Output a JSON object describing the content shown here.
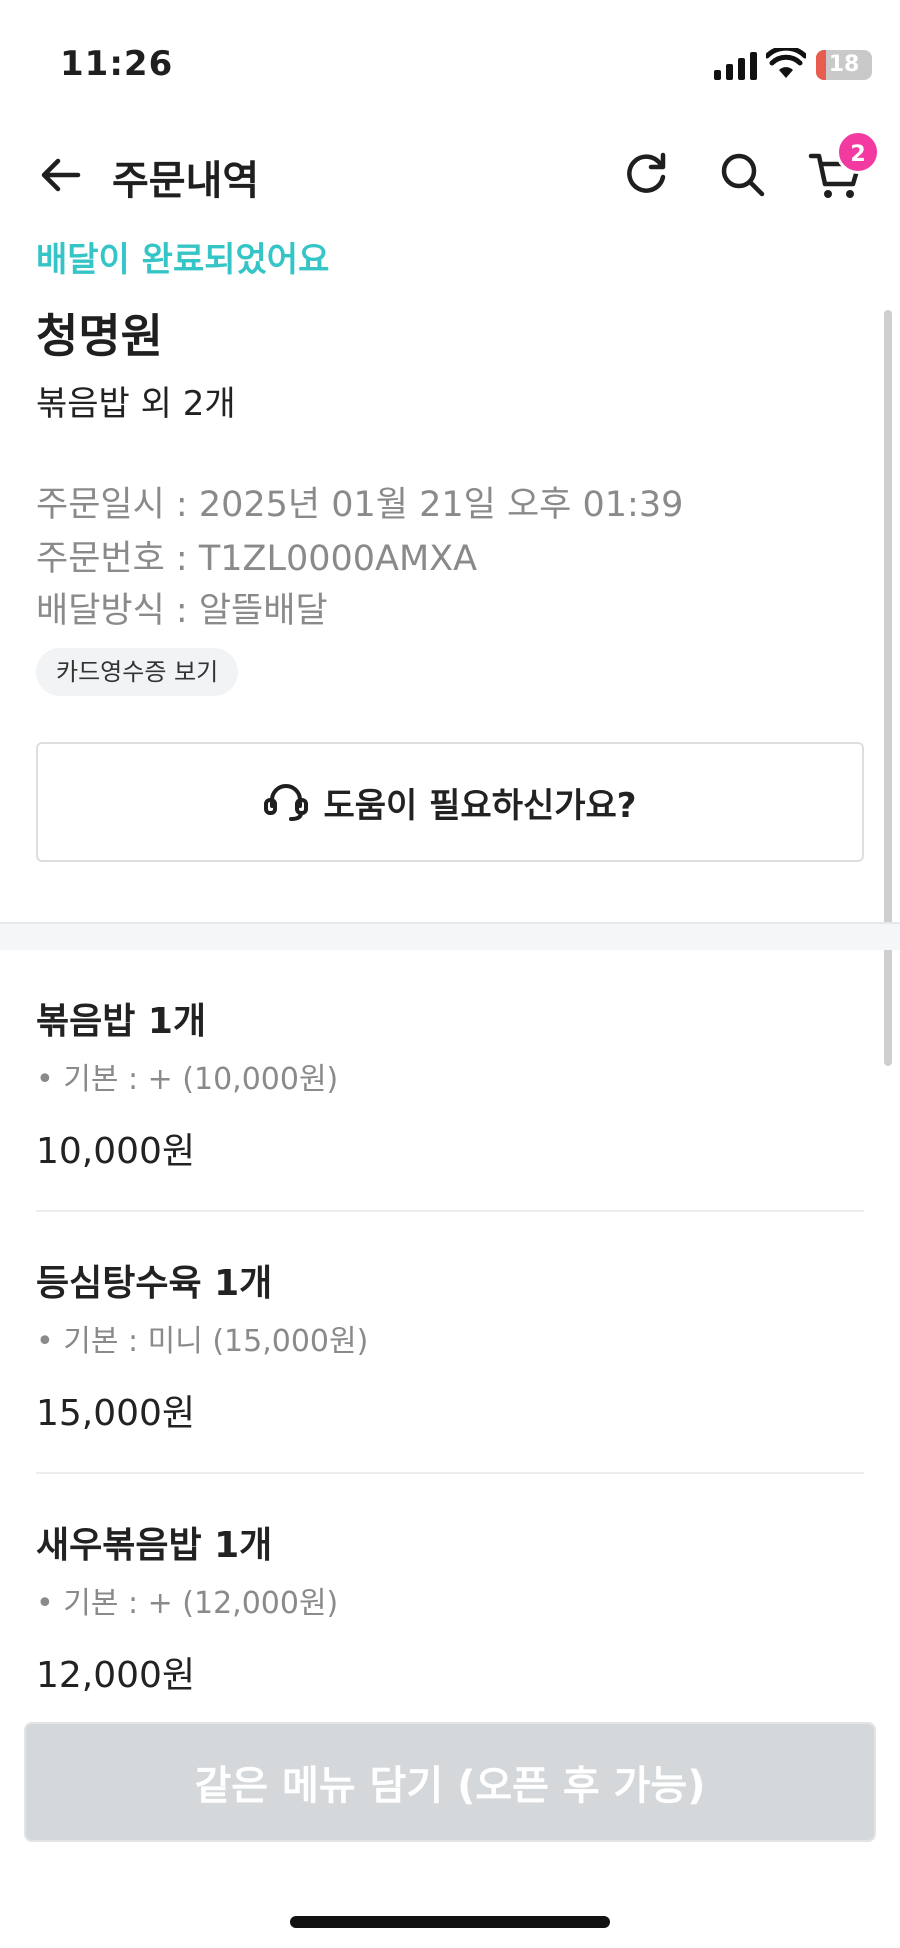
{
  "status_bar": {
    "time": "11:26",
    "battery_level": "18",
    "battery_fraction": 0.18
  },
  "nav": {
    "title": "주문내역",
    "cart_count": "2",
    "icons": [
      "back-arrow-icon",
      "refresh-icon",
      "search-icon",
      "cart-icon"
    ]
  },
  "order": {
    "status": "배달이 완료되었어요",
    "store_name": "청명원",
    "summary": "볶음밥 외 2개",
    "date_line": "주문일시 : 2025년 01월 21일 오후 01:39",
    "number_line": "주문번호 : T1ZL0000AMXA",
    "method_line": "배달방식 : 알뜰배달",
    "receipt_label": "카드영수증 보기",
    "help_label": "도움이 필요하신가요?"
  },
  "items": [
    {
      "name": "볶음밥 1개",
      "option": "• 기본 : + (10,000원)",
      "price": "10,000원"
    },
    {
      "name": "등심탕수육 1개",
      "option": "• 기본 : 미니 (15,000원)",
      "price": "15,000원"
    },
    {
      "name": "새우볶음밥 1개",
      "option": "• 기본 : + (12,000원)",
      "price": "12,000원"
    }
  ],
  "bottom": {
    "reorder_label": "같은 메뉴 담기 (오픈 후 가능)"
  },
  "colors": {
    "accent": "#35c5c7",
    "badge": "#f23aa0",
    "disabled_button": "#d5d8da",
    "battery_low": "#e85b4f"
  }
}
